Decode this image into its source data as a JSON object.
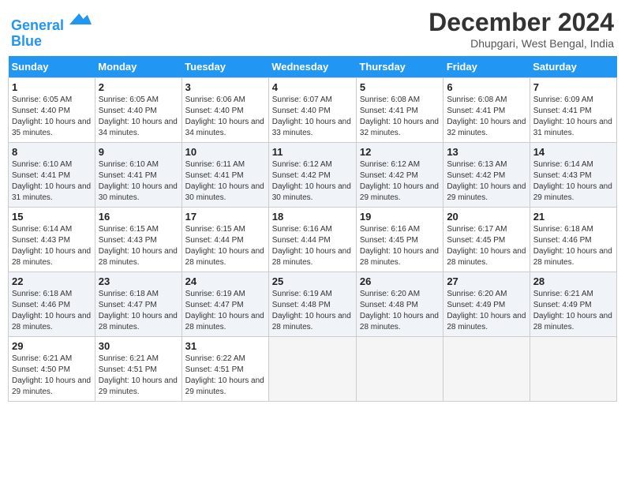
{
  "header": {
    "logo_line1": "General",
    "logo_line2": "Blue",
    "month": "December 2024",
    "location": "Dhupgari, West Bengal, India"
  },
  "days_of_week": [
    "Sunday",
    "Monday",
    "Tuesday",
    "Wednesday",
    "Thursday",
    "Friday",
    "Saturday"
  ],
  "weeks": [
    [
      {
        "day": 1,
        "rise": "6:05 AM",
        "set": "4:40 PM",
        "daylight": "10 hours and 35 minutes."
      },
      {
        "day": 2,
        "rise": "6:05 AM",
        "set": "4:40 PM",
        "daylight": "10 hours and 34 minutes."
      },
      {
        "day": 3,
        "rise": "6:06 AM",
        "set": "4:40 PM",
        "daylight": "10 hours and 34 minutes."
      },
      {
        "day": 4,
        "rise": "6:07 AM",
        "set": "4:40 PM",
        "daylight": "10 hours and 33 minutes."
      },
      {
        "day": 5,
        "rise": "6:08 AM",
        "set": "4:41 PM",
        "daylight": "10 hours and 32 minutes."
      },
      {
        "day": 6,
        "rise": "6:08 AM",
        "set": "4:41 PM",
        "daylight": "10 hours and 32 minutes."
      },
      {
        "day": 7,
        "rise": "6:09 AM",
        "set": "4:41 PM",
        "daylight": "10 hours and 31 minutes."
      }
    ],
    [
      {
        "day": 8,
        "rise": "6:10 AM",
        "set": "4:41 PM",
        "daylight": "10 hours and 31 minutes."
      },
      {
        "day": 9,
        "rise": "6:10 AM",
        "set": "4:41 PM",
        "daylight": "10 hours and 30 minutes."
      },
      {
        "day": 10,
        "rise": "6:11 AM",
        "set": "4:41 PM",
        "daylight": "10 hours and 30 minutes."
      },
      {
        "day": 11,
        "rise": "6:12 AM",
        "set": "4:42 PM",
        "daylight": "10 hours and 30 minutes."
      },
      {
        "day": 12,
        "rise": "6:12 AM",
        "set": "4:42 PM",
        "daylight": "10 hours and 29 minutes."
      },
      {
        "day": 13,
        "rise": "6:13 AM",
        "set": "4:42 PM",
        "daylight": "10 hours and 29 minutes."
      },
      {
        "day": 14,
        "rise": "6:14 AM",
        "set": "4:43 PM",
        "daylight": "10 hours and 29 minutes."
      }
    ],
    [
      {
        "day": 15,
        "rise": "6:14 AM",
        "set": "4:43 PM",
        "daylight": "10 hours and 28 minutes."
      },
      {
        "day": 16,
        "rise": "6:15 AM",
        "set": "4:43 PM",
        "daylight": "10 hours and 28 minutes."
      },
      {
        "day": 17,
        "rise": "6:15 AM",
        "set": "4:44 PM",
        "daylight": "10 hours and 28 minutes."
      },
      {
        "day": 18,
        "rise": "6:16 AM",
        "set": "4:44 PM",
        "daylight": "10 hours and 28 minutes."
      },
      {
        "day": 19,
        "rise": "6:16 AM",
        "set": "4:45 PM",
        "daylight": "10 hours and 28 minutes."
      },
      {
        "day": 20,
        "rise": "6:17 AM",
        "set": "4:45 PM",
        "daylight": "10 hours and 28 minutes."
      },
      {
        "day": 21,
        "rise": "6:18 AM",
        "set": "4:46 PM",
        "daylight": "10 hours and 28 minutes."
      }
    ],
    [
      {
        "day": 22,
        "rise": "6:18 AM",
        "set": "4:46 PM",
        "daylight": "10 hours and 28 minutes."
      },
      {
        "day": 23,
        "rise": "6:18 AM",
        "set": "4:47 PM",
        "daylight": "10 hours and 28 minutes."
      },
      {
        "day": 24,
        "rise": "6:19 AM",
        "set": "4:47 PM",
        "daylight": "10 hours and 28 minutes."
      },
      {
        "day": 25,
        "rise": "6:19 AM",
        "set": "4:48 PM",
        "daylight": "10 hours and 28 minutes."
      },
      {
        "day": 26,
        "rise": "6:20 AM",
        "set": "4:48 PM",
        "daylight": "10 hours and 28 minutes."
      },
      {
        "day": 27,
        "rise": "6:20 AM",
        "set": "4:49 PM",
        "daylight": "10 hours and 28 minutes."
      },
      {
        "day": 28,
        "rise": "6:21 AM",
        "set": "4:49 PM",
        "daylight": "10 hours and 28 minutes."
      }
    ],
    [
      {
        "day": 29,
        "rise": "6:21 AM",
        "set": "4:50 PM",
        "daylight": "10 hours and 29 minutes."
      },
      {
        "day": 30,
        "rise": "6:21 AM",
        "set": "4:51 PM",
        "daylight": "10 hours and 29 minutes."
      },
      {
        "day": 31,
        "rise": "6:22 AM",
        "set": "4:51 PM",
        "daylight": "10 hours and 29 minutes."
      },
      null,
      null,
      null,
      null
    ]
  ]
}
